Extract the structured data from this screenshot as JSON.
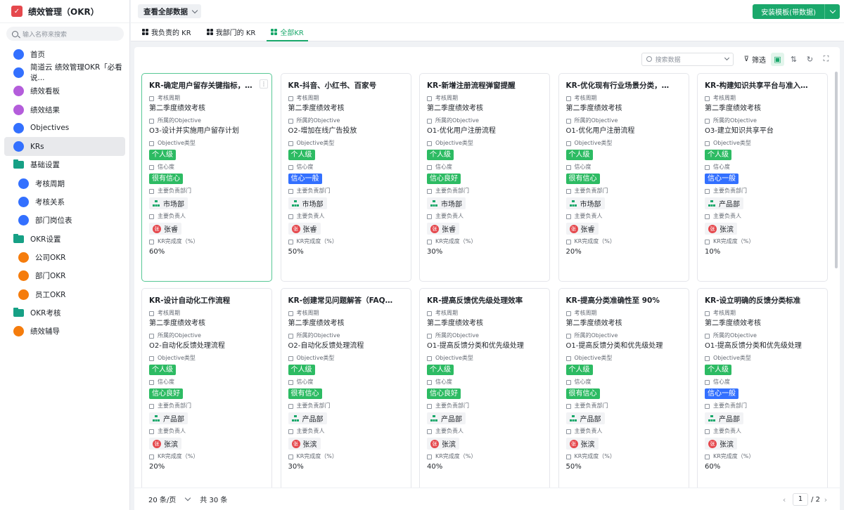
{
  "app": {
    "title": "绩效管理（OKR）",
    "logo_text": "✓"
  },
  "sidebar": {
    "search_placeholder": "输入名称来搜索",
    "items": [
      {
        "label": "首页",
        "icon": "home-icon",
        "color": "blue"
      },
      {
        "label": "简道云 绩效管理OKR「必看说...",
        "icon": "document-icon",
        "color": "blue"
      },
      {
        "label": "绩效看板",
        "icon": "dashboard-icon",
        "color": "purple"
      },
      {
        "label": "绩效结果",
        "icon": "result-icon",
        "color": "purple"
      },
      {
        "label": "Objectives",
        "icon": "target-icon",
        "color": "blue"
      },
      {
        "label": "KRs",
        "icon": "bookmark-icon",
        "color": "blue",
        "active": true
      },
      {
        "label": "基础设置",
        "icon": "folder-icon",
        "color": "folder"
      },
      {
        "label": "考核周期",
        "icon": "calendar-icon",
        "color": "blue",
        "sub": true
      },
      {
        "label": "考核关系",
        "icon": "relation-icon",
        "color": "blue",
        "sub": true
      },
      {
        "label": "部门岗位表",
        "icon": "table-icon",
        "color": "blue",
        "sub": true
      },
      {
        "label": "OKR设置",
        "icon": "folder-icon",
        "color": "folder"
      },
      {
        "label": "公司OKR",
        "icon": "company-icon",
        "color": "orange",
        "sub": true
      },
      {
        "label": "部门OKR",
        "icon": "department-icon",
        "color": "orange",
        "sub": true
      },
      {
        "label": "员工OKR",
        "icon": "employee-icon",
        "color": "orange",
        "sub": true
      },
      {
        "label": "OKR考核",
        "icon": "folder-icon",
        "color": "folder"
      },
      {
        "label": "绩效辅导",
        "icon": "coach-icon",
        "color": "orange"
      }
    ]
  },
  "topbar": {
    "view_label": "查看全部数据",
    "install_label": "安装模板(带数据)"
  },
  "tabs": [
    {
      "label": "我负责的 KR",
      "active": false
    },
    {
      "label": "我部门的 KR",
      "active": false
    },
    {
      "label": "全部KR",
      "active": true
    }
  ],
  "toolbar": {
    "search_placeholder": "搜索数据",
    "filter_label": "筛选"
  },
  "field_labels": {
    "period": "考核周期",
    "objective": "所属的Objective",
    "type": "Objective类型",
    "confidence": "信心度",
    "dept": "主要负责部门",
    "owner": "主要负责人",
    "progress": "KR完成度（%）"
  },
  "colors": {
    "accent": "#1aa86b",
    "tag_green": "#2dbb63",
    "tag_blue": "#3370ff",
    "avatar": "#e5484d"
  },
  "cards": [
    {
      "title": "KR-确定用户留存关键指标，制...",
      "period": "第二季度绩效考核",
      "objective": "O3-设计并实施用户留存计划",
      "type": "个人级",
      "confidence": "很有信心",
      "confidence_color": "green",
      "dept": "市场部",
      "owner": "张睿",
      "avatar": "张",
      "progress": "60%"
    },
    {
      "title": "KR-抖音、小红书、百家号",
      "period": "第二季度绩效考核",
      "objective": "O2-增加在线广告投放",
      "type": "个人级",
      "confidence": "信心一般",
      "confidence_color": "blue",
      "dept": "市场部",
      "owner": "张睿",
      "avatar": "张",
      "progress": "50%"
    },
    {
      "title": "KR-新增注册流程弹窗提醒",
      "period": "第二季度绩效考核",
      "objective": "O1-优化用户注册流程",
      "type": "个人级",
      "confidence": "信心良好",
      "confidence_color": "green",
      "dept": "市场部",
      "owner": "张睿",
      "avatar": "张",
      "progress": "30%"
    },
    {
      "title": "KR-优化现有行业场景分类，用...",
      "period": "第二季度绩效考核",
      "objective": "O1-优化用户注册流程",
      "type": "个人级",
      "confidence": "很有信心",
      "confidence_color": "green",
      "dept": "市场部",
      "owner": "张睿",
      "avatar": "张",
      "progress": "20%"
    },
    {
      "title": "KR-构建知识共享平台与准入标准",
      "period": "第二季度绩效考核",
      "objective": "O3-建立知识共享平台",
      "type": "个人级",
      "confidence": "信心一般",
      "confidence_color": "blue",
      "dept": "产品部",
      "owner": "张滨",
      "avatar": "张",
      "progress": "10%"
    },
    {
      "title": "KR-设计自动化工作流程",
      "period": "第二季度绩效考核",
      "objective": "O2-自动化反馈处理流程",
      "type": "个人级",
      "confidence": "信心良好",
      "confidence_color": "green",
      "dept": "产品部",
      "owner": "张滨",
      "avatar": "张",
      "progress": "20%"
    },
    {
      "title": "KR-创建常见问题解答（FAQ）...",
      "period": "第二季度绩效考核",
      "objective": "O2-自动化反馈处理流程",
      "type": "个人级",
      "confidence": "很有信心",
      "confidence_color": "green",
      "dept": "产品部",
      "owner": "张滨",
      "avatar": "张",
      "progress": "30%"
    },
    {
      "title": "KR-提高反馈优先级处理效率",
      "period": "第二季度绩效考核",
      "objective": "O1-提高反馈分类和优先级处理",
      "type": "个人级",
      "confidence": "信心良好",
      "confidence_color": "green",
      "dept": "产品部",
      "owner": "张滨",
      "avatar": "张",
      "progress": "40%"
    },
    {
      "title": "KR-提高分类准确性至 90%",
      "period": "第二季度绩效考核",
      "objective": "O1-提高反馈分类和优先级处理",
      "type": "个人级",
      "confidence": "很有信心",
      "confidence_color": "green",
      "dept": "产品部",
      "owner": "张滨",
      "avatar": "张",
      "progress": "50%"
    },
    {
      "title": "KR-设立明确的反馈分类标准",
      "period": "第二季度绩效考核",
      "objective": "O1-提高反馈分类和优先级处理",
      "type": "个人级",
      "confidence": "信心一般",
      "confidence_color": "blue",
      "dept": "产品部",
      "owner": "张滨",
      "avatar": "张",
      "progress": "60%"
    }
  ],
  "footer": {
    "page_size": "20 条/页",
    "total": "共 30 条",
    "current_page": "1",
    "total_pages": "/ 2"
  }
}
